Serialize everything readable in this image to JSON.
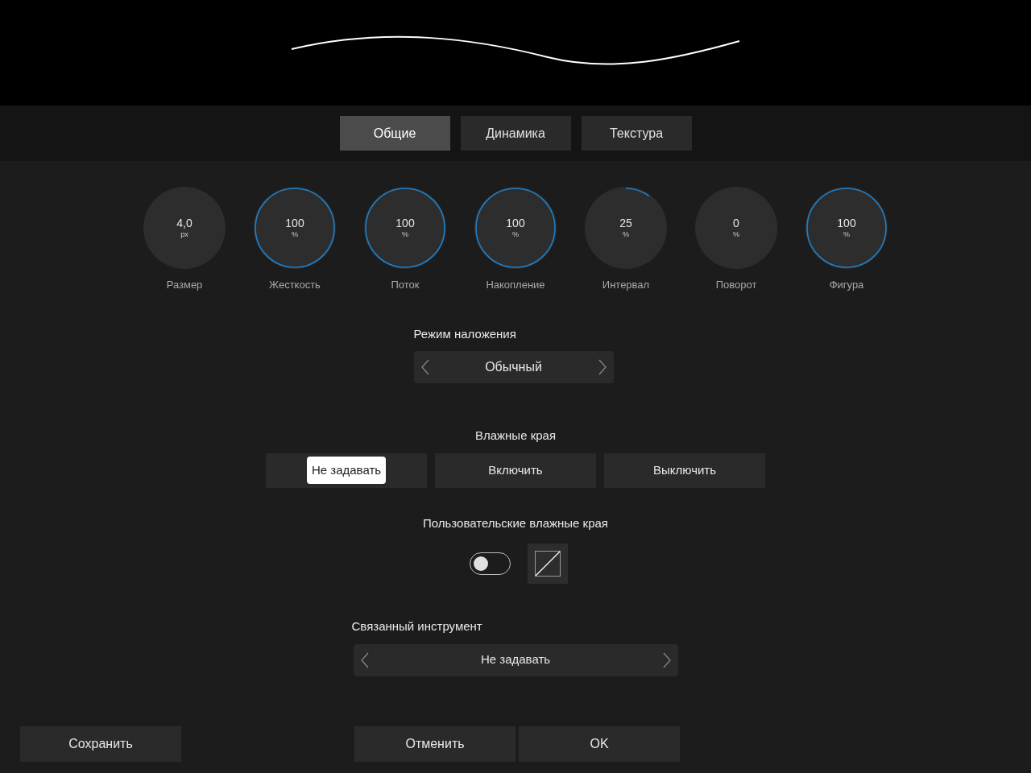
{
  "tabs": [
    {
      "label": "Общие",
      "selected": true
    },
    {
      "label": "Динамика",
      "selected": false
    },
    {
      "label": "Текстура",
      "selected": false
    }
  ],
  "dials": [
    {
      "value": "4,0",
      "unit": "px",
      "label": "Размер",
      "level": 0
    },
    {
      "value": "100",
      "unit": "%",
      "label": "Жесткость",
      "level": 1
    },
    {
      "value": "100",
      "unit": "%",
      "label": "Поток",
      "level": 1
    },
    {
      "value": "100",
      "unit": "%",
      "label": "Накопление",
      "level": 1
    },
    {
      "value": "25",
      "unit": "%",
      "label": "Интервал",
      "level": 0.1
    },
    {
      "value": "0",
      "unit": "%",
      "label": "Поворот",
      "level": 0
    },
    {
      "value": "100",
      "unit": "%",
      "label": "Фигура",
      "level": 1
    }
  ],
  "blend_mode": {
    "label": "Режим наложения",
    "value": "Обычный"
  },
  "wet_edges": {
    "label": "Влажные края",
    "options": [
      {
        "label": "Не задавать",
        "selected": true
      },
      {
        "label": "Включить",
        "selected": false
      },
      {
        "label": "Выключить",
        "selected": false
      }
    ]
  },
  "custom_wet_edges": {
    "label": "Пользовательские влажные края",
    "on": false
  },
  "linked_tool": {
    "label": "Связанный инструмент",
    "value": "Не задавать"
  },
  "buttons": {
    "save": "Сохранить",
    "cancel": "Отменить",
    "ok": "OK"
  }
}
